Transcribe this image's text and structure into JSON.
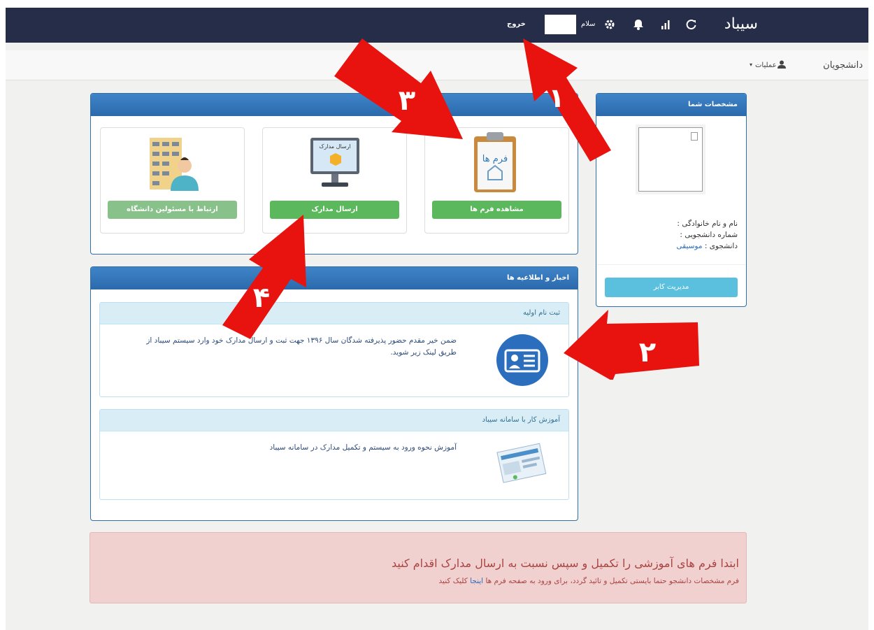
{
  "topbar": {
    "brand": "سیباد",
    "greeting": "سلام",
    "logout": "خروج",
    "icons": [
      "refresh-icon",
      "bar-chart-icon",
      "bell-icon",
      "gear-icon"
    ]
  },
  "navbar": {
    "title": "دانشجویان",
    "operations": "عملیات"
  },
  "profile": {
    "header": "مشخصات شما",
    "name_label": "نام و نام خانوادگی :",
    "student_no_label": "شماره دانشجویی :",
    "student_label": "دانشجوی :",
    "major": "موسیقی",
    "manage_button": "مدیریت کابر"
  },
  "services": {
    "cards": [
      {
        "button": "مشاهده فرم ها",
        "image_text": "فرم ها"
      },
      {
        "button": "ارسال مدارک",
        "image_text": "ارسال مدارک"
      },
      {
        "button": "ارتباط با مسئولین دانشگاه"
      }
    ]
  },
  "news": {
    "header": "اخبار و اطلاعیه ها",
    "items": [
      {
        "title": "ثبت نام اولیه",
        "text": "ضمن خیر مقدم حضور پذیرفته شدگان سال ۱۳۹۶ جهت ثبت و ارسال مدارک خود وارد سیستم سیباد از طریق لینک زیر شوید."
      },
      {
        "title": "آموزش کار با سامانه سیباد",
        "text": "آموزش نحوه ورود به سیستم و تکمیل مدارک در سامانه سیباد"
      }
    ]
  },
  "alert": {
    "title": "ابتدا فرم های آموزشی را تکمیل و سپس نسبت به ارسال مدارک اقدام کنید",
    "text_before": "فرم مشخصات دانشجو حتما بایستی تکمیل و تائید گردد، برای ورود به صفحه فرم ها",
    "link": "اینجا",
    "text_after": "کلیک کنید"
  },
  "annotations": [
    "۱",
    "۲",
    "۳",
    "۴"
  ],
  "colors": {
    "topbar": "#262d48",
    "panel_header": "#337ab7",
    "green": "#5cb85c",
    "alert_bg": "#f1d0d0",
    "arrow": "#e8120f"
  }
}
